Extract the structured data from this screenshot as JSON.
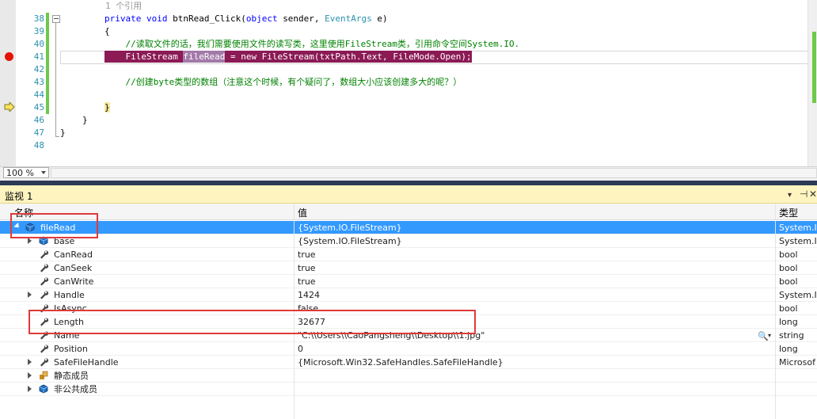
{
  "editor": {
    "ref_hint": "1 个引用",
    "lines": [
      {
        "num": "38",
        "parts": [
          [
            "kw",
            "private "
          ],
          [
            "kw",
            "void "
          ],
          [
            "tx",
            "btnRead_Click("
          ],
          [
            "kw",
            "object "
          ],
          [
            "tx",
            "sender, "
          ],
          [
            "ty",
            "EventArgs "
          ],
          [
            "tx",
            "e)"
          ]
        ]
      },
      {
        "num": "39",
        "parts": [
          [
            "tx",
            "{"
          ]
        ]
      },
      {
        "num": "40",
        "parts": [
          [
            "cm",
            "    //读取文件的话，我们需要使用文件的读写类，这里使用FileStream类，引用命令空间System.IO."
          ]
        ]
      },
      {
        "num": "41",
        "parts": [
          [
            "hl",
            "    FileStream "
          ],
          [
            "hv",
            "fileRead"
          ],
          [
            "hl",
            " = new FileStream(txtPath.Text, FileMode.Open);"
          ]
        ]
      },
      {
        "num": "42",
        "parts": []
      },
      {
        "num": "43",
        "parts": [
          [
            "cm",
            "    //创建byte类型的数组（注意这个时候，有个疑问了，数组大小应该创建多大的呢？）"
          ]
        ]
      },
      {
        "num": "44",
        "parts": []
      },
      {
        "num": "45",
        "parts": [
          [
            "bh",
            "}"
          ]
        ]
      },
      {
        "num": "46",
        "parts": [
          [
            "tx",
            "}"
          ]
        ]
      },
      {
        "num": "47",
        "parts": [
          [
            "tx",
            "}"
          ]
        ]
      },
      {
        "num": "48",
        "parts": []
      }
    ],
    "zoom": "100 %"
  },
  "watch": {
    "title": "监视 1",
    "menu_icon": "▾",
    "pin_icon": "⊣",
    "close_icon": "✕",
    "columns": {
      "name": "名称",
      "value": "值",
      "type": "类型"
    },
    "rows": [
      {
        "name": "fileRead",
        "value": "{System.IO.FileStream}",
        "type": "System.I",
        "indent": 0,
        "expander": "down",
        "icon": "object-icon",
        "selected": true
      },
      {
        "name": "base",
        "value": "{System.IO.FileStream}",
        "type": "System.I",
        "indent": 1,
        "expander": "right",
        "icon": "object-icon"
      },
      {
        "name": "CanRead",
        "value": "true",
        "type": "bool",
        "indent": 1,
        "expander": "",
        "icon": "wrench-icon"
      },
      {
        "name": "CanSeek",
        "value": "true",
        "type": "bool",
        "indent": 1,
        "expander": "",
        "icon": "wrench-icon"
      },
      {
        "name": "CanWrite",
        "value": "true",
        "type": "bool",
        "indent": 1,
        "expander": "",
        "icon": "wrench-icon"
      },
      {
        "name": "Handle",
        "value": "1424",
        "type": "System.I",
        "indent": 1,
        "expander": "right",
        "icon": "wrench-icon"
      },
      {
        "name": "IsAsync",
        "value": "false",
        "type": "bool",
        "indent": 1,
        "expander": "",
        "icon": "wrench-icon"
      },
      {
        "name": "Length",
        "value": "32677",
        "type": "long",
        "indent": 1,
        "expander": "",
        "icon": "wrench-icon"
      },
      {
        "name": "Name",
        "value": "\"C:\\\\Users\\\\CaoPangsheng\\\\Desktop\\\\1.jpg\"",
        "type": "string",
        "indent": 1,
        "expander": "",
        "icon": "wrench-icon"
      },
      {
        "name": "Position",
        "value": "0",
        "type": "long",
        "indent": 1,
        "expander": "",
        "icon": "wrench-icon"
      },
      {
        "name": "SafeFileHandle",
        "value": "{Microsoft.Win32.SafeHandles.SafeFileHandle}",
        "type": "Microsof",
        "indent": 1,
        "expander": "right",
        "icon": "wrench-icon"
      },
      {
        "name": "静态成员",
        "value": "",
        "type": "",
        "indent": 1,
        "expander": "right",
        "icon": "static-members-icon"
      },
      {
        "name": "非公共成员",
        "value": "",
        "type": "",
        "indent": 1,
        "expander": "right",
        "icon": "object-icon"
      }
    ],
    "magnifier_icon": "🔍",
    "dropdown_icon": "▾"
  }
}
